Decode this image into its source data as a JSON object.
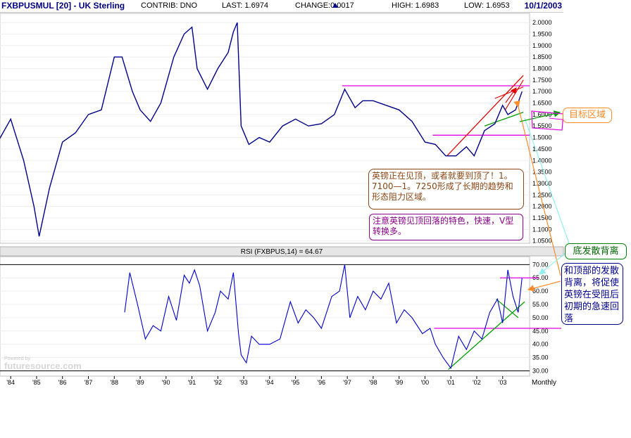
{
  "header": {
    "symbol": "FXBPUSMUL [20] - UK Sterling",
    "contrib": "CONTRIB: DNO",
    "last": "LAST: 1.6974",
    "change_label": "CHANGE:",
    "change_value": "0.0017",
    "high": "HIGH: 1.6983",
    "low": "LOW: 1.6953",
    "date": "10/1/2003"
  },
  "rsi_title": "RSI (FXBPUS,14) = 64.67",
  "watermark_small": "Powered by",
  "watermark": "futuresource.com",
  "x_axis": {
    "labels": [
      "'84",
      "'85",
      "'86",
      "'87",
      "'88",
      "'89",
      "'90",
      "'91",
      "'92",
      "'93",
      "'94",
      "'95",
      "'96",
      "'97",
      "'98",
      "'99",
      "'00",
      "'01",
      "'02",
      "'03"
    ],
    "unit": "Monthly"
  },
  "annotations": {
    "target_zone": "目标区域",
    "divergence": "底发散背离",
    "resistance_note": "英镑正在见顶，或者就要到顶了！1。7100—1。7250形成了长期的趋势和形态阻力区域。",
    "character_note": "注意英镑见顶回落的特色，快速，V型转换多。",
    "divergence_note": "和顶部的发散背离，将促使英镑在受阻后初期的急速回落"
  },
  "colors": {
    "price_line": "#00008b",
    "resistance": "#e000e0",
    "trend_green": "#00a000",
    "trend_red": "#e00000",
    "arrow_orange": "#ff8c28",
    "arrow_cyan": "#8ff0f0"
  },
  "chart_data": [
    {
      "type": "line",
      "title": "FXBPUSMUL [20] - UK Sterling",
      "ylim": [
        1.04,
        2.04
      ],
      "y_ticks": [
        "1.0500",
        "1.1000",
        "1.1500",
        "1.2000",
        "1.2500",
        "1.3000",
        "1.3500",
        "1.4000",
        "1.4500",
        "1.5000",
        "1.5500",
        "1.6000",
        "1.6500",
        "1.7000",
        "1.7500",
        "1.8000",
        "1.8500",
        "1.9000",
        "1.9500",
        "2.0000"
      ],
      "x": [
        1983.5,
        1984.0,
        1984.5,
        1984.9,
        1985.1,
        1985.5,
        1986.0,
        1986.5,
        1987.0,
        1987.5,
        1988.0,
        1988.3,
        1988.7,
        1989.0,
        1989.4,
        1989.8,
        1990.3,
        1990.7,
        1991.0,
        1991.2,
        1991.6,
        1992.0,
        1992.4,
        1992.6,
        1992.75,
        1992.9,
        1993.2,
        1993.6,
        1994.0,
        1994.5,
        1995.0,
        1995.5,
        1996.0,
        1996.5,
        1996.9,
        1997.3,
        1997.6,
        1998.0,
        1998.5,
        1999.0,
        1999.5,
        2000.0,
        2000.4,
        2000.8,
        2001.2,
        2001.6,
        2001.9,
        2002.3,
        2002.7,
        2003.0,
        2003.2,
        2003.5,
        2003.75
      ],
      "y": [
        1.48,
        1.58,
        1.4,
        1.2,
        1.07,
        1.28,
        1.48,
        1.52,
        1.6,
        1.62,
        1.85,
        1.85,
        1.7,
        1.62,
        1.57,
        1.65,
        1.85,
        1.95,
        1.98,
        1.8,
        1.71,
        1.8,
        1.87,
        1.96,
        2.0,
        1.55,
        1.47,
        1.5,
        1.48,
        1.55,
        1.58,
        1.55,
        1.56,
        1.6,
        1.71,
        1.63,
        1.66,
        1.66,
        1.64,
        1.62,
        1.57,
        1.48,
        1.47,
        1.42,
        1.42,
        1.46,
        1.42,
        1.53,
        1.56,
        1.64,
        1.6,
        1.62,
        1.7
      ],
      "resistance_level": 1.725,
      "support_level": 1.51,
      "target_zone": [
        1.56,
        1.6
      ]
    },
    {
      "type": "line",
      "title": "RSI (FXBPUS,14) = 64.67",
      "ylim": [
        28,
        73
      ],
      "y_ticks": [
        "30.00",
        "35.00",
        "40.00",
        "45.00",
        "50.00",
        "55.00",
        "60.00",
        "65.00",
        "70.00"
      ],
      "x": [
        1988.4,
        1988.6,
        1988.9,
        1989.2,
        1989.5,
        1989.8,
        1990.1,
        1990.4,
        1990.7,
        1990.9,
        1991.1,
        1991.3,
        1991.6,
        1991.9,
        1992.1,
        1992.4,
        1992.6,
        1992.8,
        1992.9,
        1993.1,
        1993.3,
        1993.6,
        1994.0,
        1994.4,
        1994.8,
        1995.1,
        1995.4,
        1995.7,
        1996.0,
        1996.4,
        1996.7,
        1996.9,
        1997.1,
        1997.4,
        1997.7,
        1998.0,
        1998.3,
        1998.6,
        1998.9,
        1999.2,
        1999.5,
        1999.9,
        2000.2,
        2000.4,
        2000.7,
        2001.0,
        2001.3,
        2001.6,
        2001.9,
        2002.2,
        2002.5,
        2002.8,
        2003.0,
        2003.2,
        2003.4,
        2003.6,
        2003.75
      ],
      "y": [
        52,
        67,
        55,
        42,
        47,
        45,
        58,
        49,
        66,
        63,
        68,
        62,
        45,
        52,
        60,
        57,
        67,
        44,
        36,
        33,
        43,
        40,
        40,
        42,
        56,
        48,
        53,
        50,
        46,
        58,
        60,
        70,
        50,
        58,
        53,
        60,
        57,
        63,
        48,
        53,
        50,
        44,
        46,
        40,
        35,
        31,
        43,
        38,
        45,
        42,
        52,
        57,
        48,
        68,
        58,
        52,
        65
      ],
      "resistance_level": 65,
      "support_level": 46
    }
  ]
}
